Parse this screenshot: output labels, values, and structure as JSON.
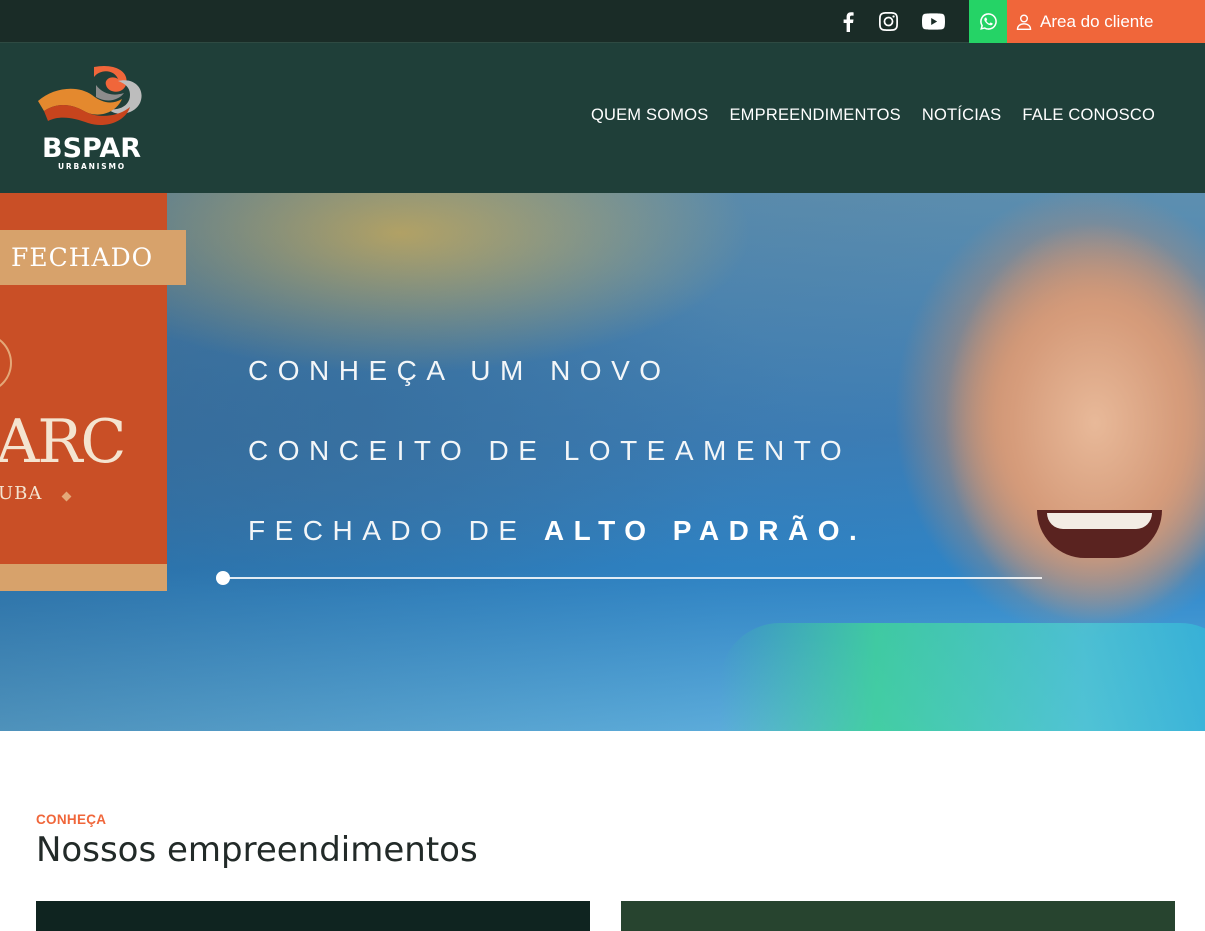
{
  "topbar": {
    "social": [
      {
        "name": "facebook"
      },
      {
        "name": "instagram"
      },
      {
        "name": "youtube"
      }
    ],
    "whatsapp_icon": "whatsapp-icon",
    "client_area_label": "Area do cliente",
    "colors": {
      "bar": "#1a2c27",
      "whatsapp": "#25d366",
      "client": "#f0663a"
    }
  },
  "header": {
    "logo_text": "BSPAR",
    "logo_subtext": "URBANISMO",
    "nav": [
      "QUEM SOMOS",
      "EMPREENDIMENTOS",
      "NOTÍCIAS",
      "FALE CONOSCO"
    ],
    "colors": {
      "background": "#1f3f39"
    }
  },
  "hero": {
    "sign_tag": "FECHADO",
    "sign_big": "ARC",
    "sign_small": "UBA",
    "line1": "CONHEÇA UM NOVO",
    "line2": "CONCEITO DE LOTEAMENTO",
    "line3_prefix": "FECHADO DE ",
    "line3_bold": "ALTO PADRÃO."
  },
  "section": {
    "eyebrow": "CONHEÇA",
    "title": "Nossos empreendimentos"
  }
}
